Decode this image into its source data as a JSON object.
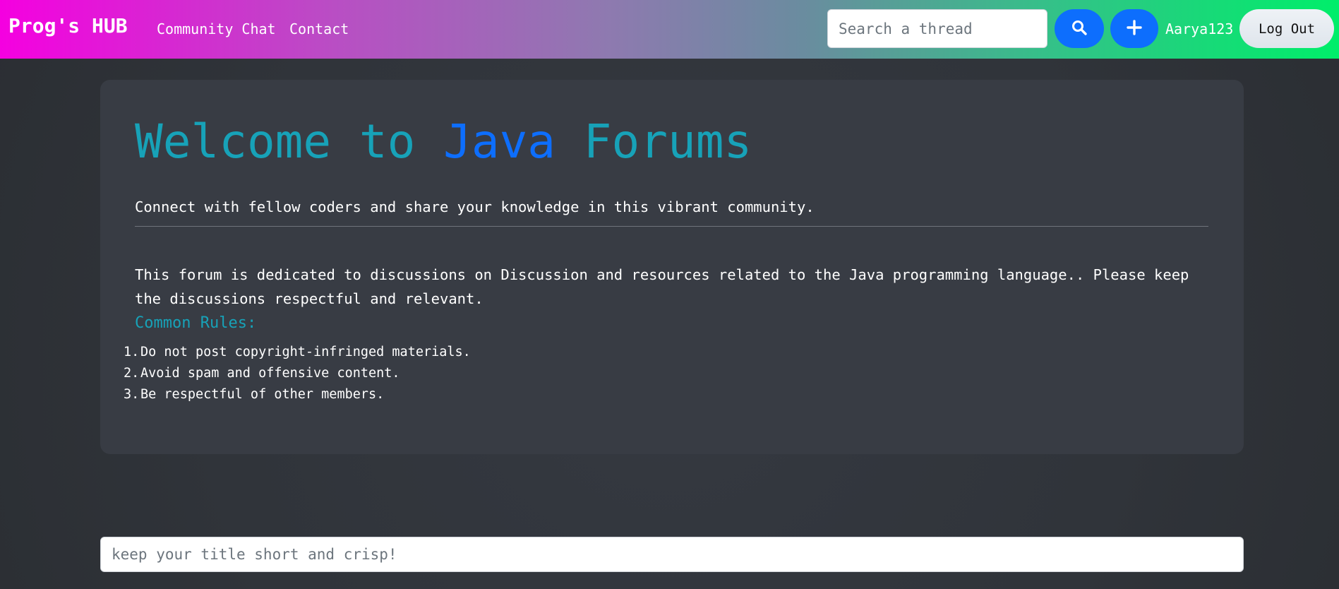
{
  "navbar": {
    "brand": "Prog's HUB",
    "links": [
      "Community Chat",
      "Contact"
    ],
    "search_placeholder": "Search a thread",
    "search_icon": "search-icon",
    "add_icon": "plus-icon",
    "username": "Aarya123",
    "logout_label": "Log Out"
  },
  "jumbotron": {
    "title_prefix": "Welcome to ",
    "title_highlight": "Java",
    "title_suffix": " Forums",
    "lead": "Connect with fellow coders and share your knowledge in this vibrant community.",
    "description": "This forum is dedicated to discussions on Discussion and resources related to the Java programming language.. Please keep the discussions respectful and relevant.",
    "rules_title": "Common Rules:",
    "rules": [
      {
        "num": "1.",
        "text": "Do not post copyright-infringed materials."
      },
      {
        "num": "2.",
        "text": "Avoid spam and offensive content."
      },
      {
        "num": "3.",
        "text": "Be respectful of other members."
      }
    ]
  },
  "post_form": {
    "title_placeholder": "keep your title short and crisp!"
  },
  "colors": {
    "accent_teal": "#17a2b8",
    "accent_blue": "#0d6efd"
  }
}
